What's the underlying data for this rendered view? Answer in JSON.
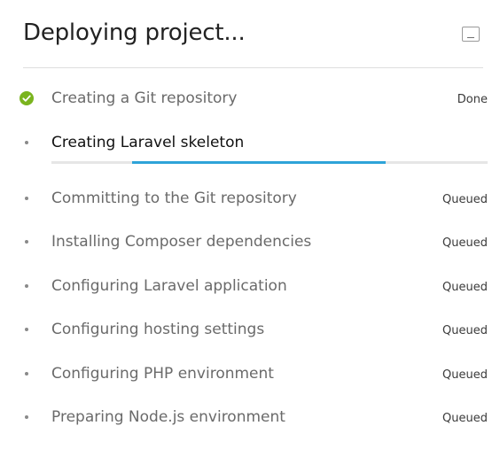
{
  "header": {
    "title": "Deploying project..."
  },
  "colors": {
    "done_check": "#7ab41e",
    "progress": "#2ea3d8",
    "track": "#e6e6e6"
  },
  "steps": [
    {
      "label": "Creating a Git repository",
      "status": "Done",
      "state": "done"
    },
    {
      "label": "Creating Laravel skeleton",
      "status": "",
      "state": "active"
    },
    {
      "label": "Committing to the Git repository",
      "status": "Queued",
      "state": "queued"
    },
    {
      "label": "Installing Composer dependencies",
      "status": "Queued",
      "state": "queued"
    },
    {
      "label": "Configuring Laravel application",
      "status": "Queued",
      "state": "queued"
    },
    {
      "label": "Configuring hosting settings",
      "status": "Queued",
      "state": "queued"
    },
    {
      "label": "Configuring PHP environment",
      "status": "Queued",
      "state": "queued"
    },
    {
      "label": "Preparing Node.js environment",
      "status": "Queued",
      "state": "queued"
    }
  ],
  "progress": {
    "indeterminate": true,
    "segment_start": 0.185,
    "segment_end": 0.767
  },
  "icons": {
    "done": "check-circle-icon",
    "pending": "bullet-icon",
    "minimize": "minimize-icon"
  }
}
